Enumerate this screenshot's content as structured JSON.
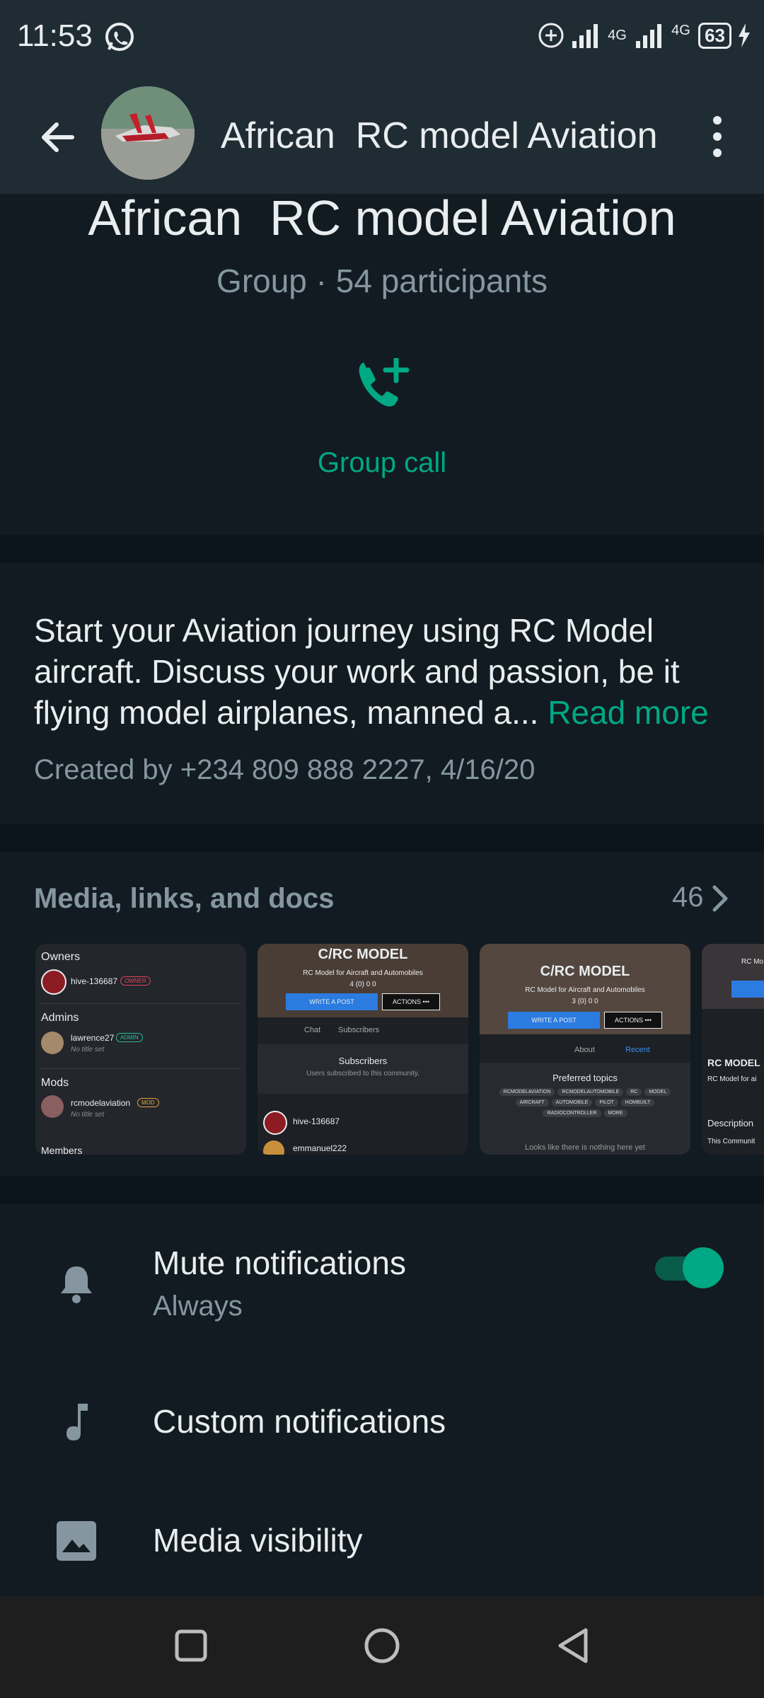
{
  "status": {
    "time": "11:53",
    "battery": "63",
    "net1": "4G",
    "net2": "4G"
  },
  "header": {
    "title": "African  RC model Aviation"
  },
  "group": {
    "name": "African  RC model Aviation",
    "subtitle": "Group · 54 participants",
    "call_label": "Group call"
  },
  "description": {
    "text": "Start your Aviation journey using RC  Model aircraft. Discuss your work and passion, be it flying model airplanes, manned a... ",
    "read_more": "Read more",
    "created_by": "Created by +234 809 888 2227, 4/16/20"
  },
  "media": {
    "title": "Media, links, and docs",
    "count": "46",
    "thumb1": {
      "owners": "Owners",
      "owner_name": "hive-136687",
      "owner_badge": "OWNER",
      "admins": "Admins",
      "admin_name": "lawrence27",
      "admin_badge": "ADMIN",
      "no_title": "No title set",
      "mods": "Mods",
      "mod_name": "rcmodelaviation",
      "mod_badge": "MOD",
      "members": "Members"
    },
    "thumb2": {
      "title": "C/RC MODEL",
      "sub": "RC Model for Aircraft and Automobiles",
      "stats": "4 (0)   0   0",
      "write": "WRITE A POST",
      "actions": "ACTIONS •••",
      "chat": "Chat",
      "subscribers_tab": "Subscribers",
      "subs_title": "Subscribers",
      "subs_sub": "Users subscribed to this community.",
      "user1": "hive-136687",
      "user2": "emmanuel222"
    },
    "thumb3": {
      "title": "C/RC MODEL",
      "sub": "RC Model for Aircraft and Automobiles",
      "stats": "3 (0)   0   0",
      "write": "WRITE A POST",
      "actions": "ACTIONS •••",
      "about": "About",
      "recent": "Recent",
      "topics_title": "Preferred topics",
      "tags": [
        "RCMODELAVIATION",
        "RCMODELAUTOMOBILE",
        "RC",
        "MODEL",
        "AIRCRAFT",
        "AUTOMOBILE",
        "PILOT",
        "HOMBUILT",
        "RADIOCONTROLLER",
        "MORE"
      ],
      "empty": "Looks like there is nothing here yet"
    },
    "thumb4": {
      "t1": "RC Mo",
      "t2": "RC MODEL",
      "t3": "RC Model for ai",
      "t4": "Description",
      "t5": "This Communit"
    }
  },
  "settings": {
    "mute_title": "Mute notifications",
    "mute_sub": "Always",
    "mute_on": true,
    "custom_title": "Custom notifications",
    "media_title": "Media visibility"
  },
  "colors": {
    "accent": "#00a884",
    "bg": "#111b21",
    "header": "#202c33",
    "muted": "#8696a0"
  }
}
